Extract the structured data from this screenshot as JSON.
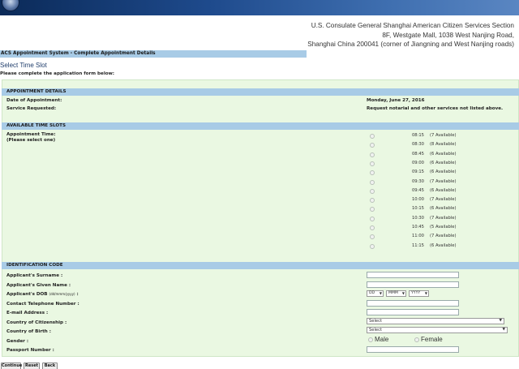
{
  "header": {
    "address_lines": [
      "U.S. Consulate General Shanghai American Citizen Services Section",
      "8F, Westgate Mall, 1038 West Nanjing Road,",
      "Shanghai China 200041 (corner of Jiangning and West Nanjing roads)"
    ]
  },
  "system_title": "ACS Appointment System - Complete Appointment Details",
  "page_title": "Select Time Slot",
  "instructions": "Please complete the application form below:",
  "appointment_details": {
    "heading": "APPOINTMENT DETAILS",
    "date_label": "Date of Appointment:",
    "date_value": "Monday, June 27, 2016",
    "service_label": "Service Requested:",
    "service_value": "Request notarial and other services not listed above."
  },
  "time_slots": {
    "heading": "AVAILABLE TIME SLOTS",
    "label_line1": "Appointment Time:",
    "label_line2": "(Please select one)",
    "slots": [
      {
        "time": "08:15",
        "availability": "(7 Available)"
      },
      {
        "time": "08:30",
        "availability": "(8 Available)"
      },
      {
        "time": "08:45",
        "availability": "(6 Available)"
      },
      {
        "time": "09:00",
        "availability": "(6 Available)"
      },
      {
        "time": "09:15",
        "availability": "(6 Available)"
      },
      {
        "time": "09:30",
        "availability": "(7 Available)"
      },
      {
        "time": "09:45",
        "availability": "(6 Available)"
      },
      {
        "time": "10:00",
        "availability": "(7 Available)"
      },
      {
        "time": "10:15",
        "availability": "(6 Available)"
      },
      {
        "time": "10:30",
        "availability": "(7 Available)"
      },
      {
        "time": "10:45",
        "availability": "(5 Available)"
      },
      {
        "time": "11:00",
        "availability": "(7 Available)"
      },
      {
        "time": "11:15",
        "availability": "(6 Available)"
      }
    ]
  },
  "identification": {
    "heading": "IDENTIFICATION CODE",
    "surname_label": "Applicant's Surname :",
    "surname_value": "",
    "given_name_label": "Applicant's Given Name :",
    "given_name_value": "",
    "dob_label": "Applicant's DOB",
    "dob_format": "(dd/mmm/yyyy)",
    "dob_day": "DD",
    "dob_month": "MMM",
    "dob_year": "YYYY",
    "phone_label": "Contact Telephone Number :",
    "phone_value": "",
    "email_label": "E-mail Address :",
    "email_value": "",
    "citizenship_label": "Country of Citizenship :",
    "citizenship_value": "Select",
    "birth_label": "Country of Birth :",
    "birth_value": "Select",
    "gender_label": "Gender :",
    "gender_male": "Male",
    "gender_female": "Female",
    "passport_label": "Passport Number :",
    "passport_value": ""
  },
  "buttons": {
    "continue": "Continue",
    "reset": "Reset",
    "back": "Back"
  },
  "icons": {
    "seal": "consulate-seal-icon",
    "dropdown": "chevron-down-icon"
  },
  "colors": {
    "header_gradient_start": "#0b2a58",
    "section_header": "#a8cbe6",
    "form_background": "#eaf8e2"
  }
}
